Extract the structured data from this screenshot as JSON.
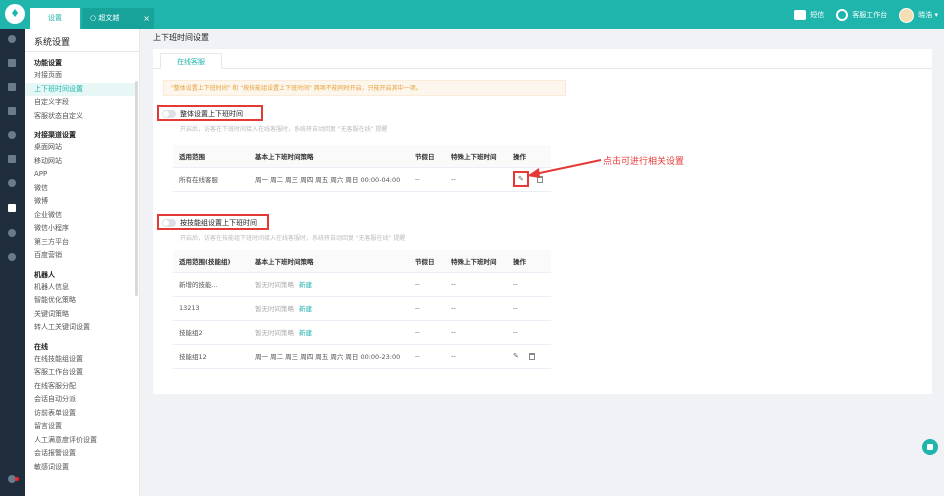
{
  "topbar": {
    "tabs": [
      {
        "label": "设置"
      },
      {
        "label": "超文越",
        "close": "×"
      }
    ],
    "right": {
      "sms": "短信",
      "workbench": "客服工作台",
      "user": "晓浩 ▾"
    }
  },
  "sidebar": {
    "title": "系统设置",
    "groups": [
      {
        "label": "功能设置",
        "items": [
          "对接页面",
          "上下班时间设置",
          "自定义字段",
          "客服状态自定义"
        ]
      },
      {
        "label": "对接渠道设置",
        "items": [
          "桌面网站",
          "移动网站",
          "APP",
          "微信",
          "微博",
          "企业微信",
          "微信小程序",
          "第三方平台",
          "百度营销"
        ]
      },
      {
        "label": "机器人",
        "items": [
          "机器人信息",
          "智能优化策略",
          "关键词策略",
          "转人工关键词设置"
        ]
      },
      {
        "label": "在线",
        "items": [
          "在线技能组设置",
          "客服工作台设置",
          "在线客服分配",
          "会话自动分派",
          "访前表单设置",
          "留言设置",
          "人工满意度评价设置",
          "会话报警设置",
          "敏感词设置"
        ]
      }
    ],
    "active": "上下班时间设置"
  },
  "main": {
    "page_title": "上下班时间设置",
    "tab": "在线客服",
    "warning": "\"整体设置上下班时间\" 和 \"按技能组设置上下班时间\" 两项不能同时开启，只能开启其中一项。",
    "section1": {
      "title": "整体设置上下班时间",
      "hint": "开启后，访客在下班时间接入在线客服时，系统将自动回复 \"无客服在线\" 提醒",
      "headers": [
        "适用范围",
        "基本上下班时间策略",
        "节假日",
        "特殊上下班时间",
        "操作"
      ],
      "rows": [
        {
          "scope": "所有在线客服",
          "policy": "周一 周二 周三 周四 周五 周六 周日 00:00-04:00",
          "holiday": "--",
          "special": "--"
        }
      ]
    },
    "section2": {
      "title": "按技能组设置上下班时间",
      "hint": "开启后，访客在技能组下班时间接入在线客服时，系统将自动回复 \"无客服在线\" 提醒",
      "headers": [
        "适用范围(技能组)",
        "基本上下班时间策略",
        "节假日",
        "特殊上下班时间",
        "操作"
      ],
      "rows": [
        {
          "scope": "新增的技能...",
          "policy": "暂无时间策略",
          "link": "新建",
          "holiday": "--",
          "special": "--",
          "op": "--"
        },
        {
          "scope": "13213",
          "policy": "暂无时间策略",
          "link": "新建",
          "holiday": "--",
          "special": "--",
          "op": "--"
        },
        {
          "scope": "技能组2",
          "policy": "暂无时间策略",
          "link": "新建",
          "holiday": "--",
          "special": "--",
          "op": "--"
        },
        {
          "scope": "技能组12",
          "policy": "周一 周二 周三 周四 周五 周六 周日 00:00-23:00",
          "link": "",
          "holiday": "--",
          "special": "--",
          "op": ""
        }
      ]
    },
    "annotation": "点击可进行相关设置"
  },
  "colors": {
    "brand": "#1fb5ad",
    "annotation": "#e53935",
    "warning": "#e6a23c"
  }
}
